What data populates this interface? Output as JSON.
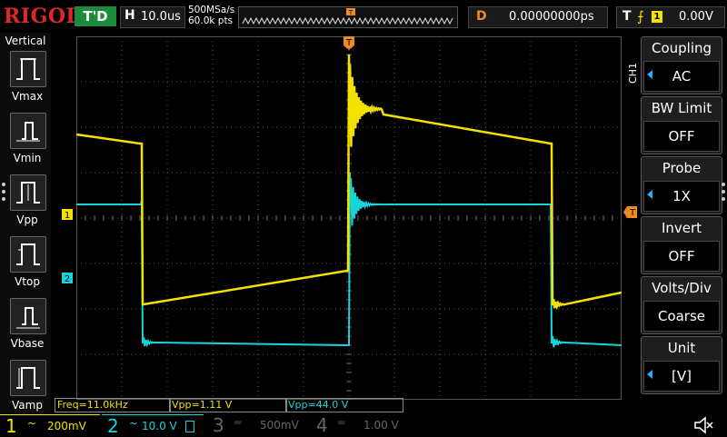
{
  "brand": "RIGOL",
  "top": {
    "trigger_status": "T'D",
    "horizontal_label": "H",
    "timebase": "10.0us",
    "sample_rate": "500MSa/s",
    "memory_depth": "60.0k pts",
    "trigger_pos_marker": "T",
    "delay_label": "D",
    "delay_value": "0.00000000ps",
    "trigger_label": "T",
    "trigger_source": "1",
    "trigger_level": "0.00V"
  },
  "left_panel": {
    "title": "Vertical",
    "items": [
      "Vmax",
      "Vmin",
      "Vpp",
      "Vtop",
      "Vbase",
      "Vamp"
    ]
  },
  "right_menu": {
    "channel_tag": "CH1",
    "items": [
      {
        "title": "Coupling",
        "value": "AC"
      },
      {
        "title": "BW Limit",
        "value": "OFF"
      },
      {
        "title": "Probe",
        "value": "1X"
      },
      {
        "title": "Invert",
        "value": "OFF"
      },
      {
        "title": "Volts/Div",
        "value": "Coarse"
      },
      {
        "title": "Unit",
        "value": "[V]"
      }
    ]
  },
  "markers": {
    "ch1": "1",
    "ch2": "2",
    "trigger_top": "T",
    "trigger_level": "T"
  },
  "measurements": {
    "freq": "Freq=11.0kHz",
    "vpp1": "Vpp=1.11 V",
    "vpp2": "Vpp=44.0 V"
  },
  "channels": [
    {
      "num": "1",
      "coupling": "~",
      "scale": "200mV",
      "color": "#f5e100",
      "active": true
    },
    {
      "num": "2",
      "coupling": "~",
      "scale": "10.0 V",
      "color": "#19d3da",
      "active": true
    },
    {
      "num": "3",
      "coupling": "═",
      "scale": "500mV",
      "color": "#666666",
      "active": false
    },
    {
      "num": "4",
      "coupling": "═",
      "scale": "1.00 V",
      "color": "#666666",
      "active": false
    }
  ],
  "colors": {
    "ch1": "#f5e100",
    "ch2": "#19d3da",
    "trigger": "#f08a22",
    "accent": "#2aa9ff",
    "brand": "#e0262a"
  },
  "icons": {
    "speaker": "speaker-muted-icon"
  }
}
